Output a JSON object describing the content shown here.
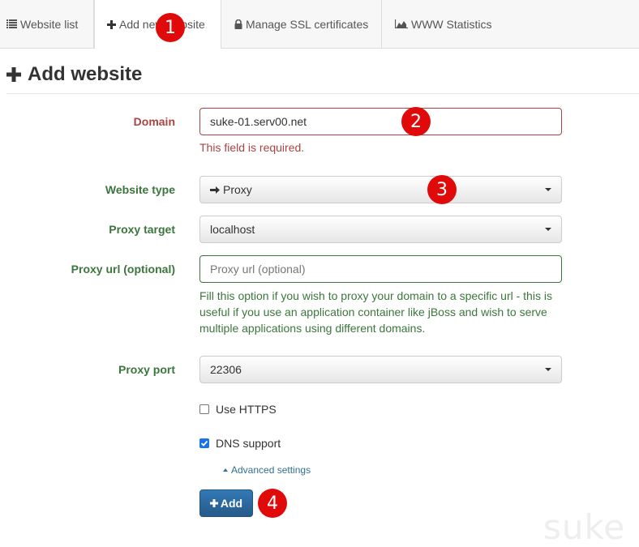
{
  "tabs": [
    {
      "label": "Website list",
      "icon": "list-icon"
    },
    {
      "label": "Add new website",
      "icon": "plus-icon"
    },
    {
      "label": "Manage SSL certificates",
      "icon": "lock-icon"
    },
    {
      "label": "WWW Statistics",
      "icon": "area-chart-icon"
    }
  ],
  "page": {
    "title": "Add website"
  },
  "form": {
    "domain": {
      "label": "Domain",
      "value": "suke-01.serv00.net",
      "error": "This field is required."
    },
    "website_type": {
      "label": "Website type",
      "value": "Proxy"
    },
    "proxy_target": {
      "label": "Proxy target",
      "value": "localhost"
    },
    "proxy_url": {
      "label": "Proxy url (optional)",
      "placeholder": "Proxy url (optional)",
      "help": "Fill this option if you wish to proxy your domain to a specific url - this is useful if you use an application container like jBoss and wish to serve multiple applications using different domains."
    },
    "proxy_port": {
      "label": "Proxy port",
      "value": "22306"
    },
    "use_https": {
      "label": "Use HTTPS",
      "checked": false
    },
    "dns_support": {
      "label": "DNS support",
      "checked": true
    },
    "advanced_link": "Advanced settings",
    "add_button": "Add"
  },
  "markers": [
    "1",
    "2",
    "3",
    "4"
  ],
  "watermark": "suke",
  "colors": {
    "error": "#a94442",
    "success": "#3c763d",
    "primary": "#337ab7",
    "marker": "#e10a0a"
  }
}
